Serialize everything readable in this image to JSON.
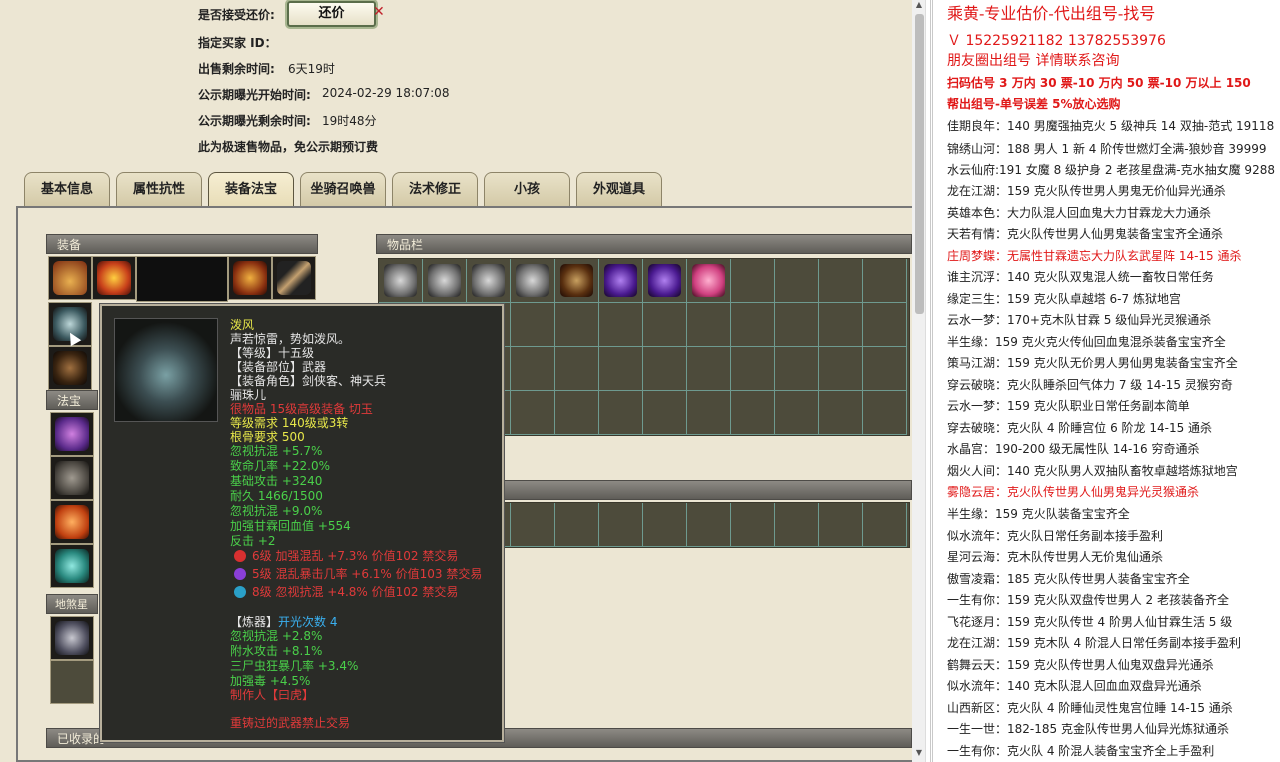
{
  "trade": {
    "accept_counter_label": "是否接受还价:",
    "counter_button": "还价",
    "buyer_label": "指定买家 ID：",
    "buyer_value": "",
    "remaining_label": "出售剩余时间:",
    "remaining_value": "6天19时",
    "public_start_label": "公示期曝光开始时间:",
    "public_start_value": "2024-02-29 18:07:08",
    "public_remain_label": "公示期曝光剩余时间:",
    "public_remain_value": "19时48分",
    "notice": "此为极速售物品，免公示期预订费"
  },
  "tabs": [
    "基本信息",
    "属性抗性",
    "装备法宝",
    "坐骑召唤兽",
    "法术修正",
    "小孩",
    "外观道具"
  ],
  "active_tab": "装备法宝",
  "sections": {
    "equipment": "装备",
    "bag": "物品栏",
    "fabao": "法宝",
    "disha": "地煞星阵",
    "collected": "已收录的"
  },
  "tooltip": {
    "name": "泼风",
    "desc": "声若惊雷，势如泼风。",
    "level": "【等级】十五级",
    "part": "【装备部位】武器",
    "role": "【装备角色】剑侠客、神天兵",
    "type": "骊珠儿",
    "quality": "很物品 15级高级装备 切玉",
    "req_level": "等级需求 140级或3转",
    "req_bone": "根骨要求 500",
    "attrs_green": [
      "忽视抗混 +5.7%",
      "致命几率 +22.0%",
      "基础攻击 +3240",
      "耐久 1466/1500",
      "忽视抗混 +9.0%",
      "加强甘霖回血值 +554",
      "反击 +2"
    ],
    "gems": [
      {
        "text": "6级 加强混乱 +7.3% 价值102 禁交易",
        "color": "#d83030"
      },
      {
        "text": "5级 混乱暴击几率 +6.1% 价值103 禁交易",
        "color": "#8a3fd8"
      },
      {
        "text": "8级 忽视抗混 +4.8% 价值102 禁交易",
        "color": "#2aa0c8"
      }
    ],
    "refine_label": "【炼器】",
    "refine_count": "开光次数 4",
    "refine_attrs": [
      "忽视抗混 +2.8%",
      "附水攻击 +8.1%",
      "三尸虫狂暴几率 +3.4%",
      "加强毒 +4.5%"
    ],
    "maker": "制作人【曰虎】",
    "warning": "重铸过的武器禁止交易"
  },
  "chat": [
    {
      "text": "乘黄-专业估价-代出组号-找号",
      "color": "#e01818",
      "size": 16
    },
    {
      "text": "Ｖ 15225921182   13782553976",
      "color": "#e01818",
      "size": 14
    },
    {
      "text": "朋友圈出组号   详情联系咨询",
      "color": "#e01818",
      "size": 14
    },
    {
      "text": "扫码估号 3 万内 30 票-10 万内 50 票-10 万以上 150",
      "color": "#e01818",
      "size": 12,
      "bold": true
    },
    {
      "text": "帮出组号-单号误差 5%放心选购",
      "color": "#e01818",
      "size": 12,
      "bold": true
    },
    {
      "text": "佳期良年：140 男魔强抽克火 5 级神兵 14 双抽-范式 19118",
      "color": "#222"
    },
    {
      "text": "锦绣山河：188 男人 1 新 4 阶传世燃灯全满-狼妙音 39999",
      "color": "#222"
    },
    {
      "text": "水云仙府:191 女魔 8 级护身 2 老孩星盘满-克水抽女魔 9288",
      "color": "#222"
    },
    {
      "text": "龙在江湖：159 克火队传世男人男鬼无价仙异光通杀",
      "color": "#222"
    },
    {
      "text": "英雄本色：大力队混人回血鬼大力甘霖龙大力通杀",
      "color": "#222"
    },
    {
      "text": "天若有情：克火队传世男人仙男鬼装备宝宝齐全通杀",
      "color": "#222"
    },
    {
      "text": "庄周梦蝶：无属性甘霖遗忘大力队玄武星阵 14-15 通杀",
      "color": "#e01818"
    },
    {
      "text": "谁主沉浮：140 克火队双鬼混人统一畜牧日常任务",
      "color": "#222"
    },
    {
      "text": "缘定三生：159 克火队卓越塔 6-7 炼狱地宫",
      "color": "#222"
    },
    {
      "text": "云水一梦：170+克木队甘霖 5 级仙异光灵猴通杀",
      "color": "#222"
    },
    {
      "text": "半生缘：159 克火克火传仙回血鬼混杀装备宝宝齐全",
      "color": "#222"
    },
    {
      "text": "策马江湖：159 克火队无价男人男仙男鬼装备宝宝齐全",
      "color": "#222"
    },
    {
      "text": "穿云破晓：克火队睡杀回气体力 7 级 14-15 灵猴穷奇",
      "color": "#222"
    },
    {
      "text": "云水一梦：159 克火队职业日常任务副本简单",
      "color": "#222"
    },
    {
      "text": "穿去破晓：克火队 4 阶睡宫位 6 阶龙 14-15 通杀",
      "color": "#222"
    },
    {
      "text": "水晶宫：190-200 级无属性队 14-16 穷奇通杀",
      "color": "#222"
    },
    {
      "text": "烟火人间：140 克火队男人双抽队畜牧卓越塔炼狱地宫",
      "color": "#222"
    },
    {
      "text": "雾隐云居：克火队传世男人仙男鬼异光灵猴通杀",
      "color": "#e01818"
    },
    {
      "text": "半生缘：159 克火队装备宝宝齐全",
      "color": "#222"
    },
    {
      "text": "似水流年：克火队日常任务副本接手盈利",
      "color": "#222"
    },
    {
      "text": "星河云海：克木队传世男人无价鬼仙通杀",
      "color": "#222"
    },
    {
      "text": "傲雪凌霜：185 克火队传世男人装备宝宝齐全",
      "color": "#222"
    },
    {
      "text": "一生有你：159 克火队双盘传世男人 2 老孩装备齐全",
      "color": "#222"
    },
    {
      "text": "飞花逐月：159 克火队传世 4 阶男人仙甘霖生活 5 级",
      "color": "#222"
    },
    {
      "text": "龙在江湖：159 克木队 4 阶混人日常任务副本接手盈利",
      "color": "#222"
    },
    {
      "text": "鹤舞云天：159 克火队传世男人仙鬼双盘异光通杀",
      "color": "#222"
    },
    {
      "text": "似水流年：140 克木队混人回血血双盘异光通杀",
      "color": "#222"
    },
    {
      "text": "山西新区：克火队 4 阶睡仙灵性鬼宫位睡 14-15 通杀",
      "color": "#222"
    },
    {
      "text": "一生一世：182-185 克金队传世男人仙异光炼狱通杀",
      "color": "#222"
    },
    {
      "text": "一生有你：克火队 4 阶混人装备宝宝齐全上手盈利",
      "color": "#222"
    }
  ]
}
